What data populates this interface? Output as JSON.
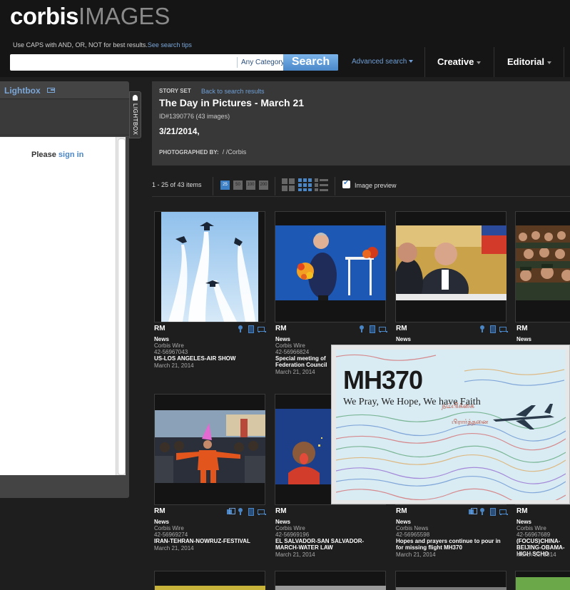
{
  "header": {
    "logo_primary": "corbis",
    "logo_secondary": "IMAGES",
    "tip_text": "Use CAPS with AND, OR, NOT for best results.",
    "tip_link": "See search tips",
    "search_placeholder": "",
    "category": "Any Category",
    "search_button": "Search",
    "advanced_search": "Advanced search",
    "nav_creative": "Creative",
    "nav_editorial": "Editorial"
  },
  "lightbox": {
    "title": "Lightbox",
    "please": "Please ",
    "sign_in": "sign in",
    "tab_label": "LIGHTBOX"
  },
  "story": {
    "kicker": "STORY SET",
    "back_link": "Back to search results",
    "title": "The Day in Pictures - March 21",
    "id_line": "ID#1390776 (43 images)",
    "date": "3/21/2014,",
    "photographed_label": "PHOTOGRAPHED BY:",
    "photographer": "/ /Corbis"
  },
  "toolbar": {
    "count": "1 - 25 of 43 items",
    "page_sizes": [
      "25",
      "50",
      "100",
      "200"
    ],
    "active_page_size": "25",
    "image_preview_label": "Image preview",
    "image_preview_checked": true
  },
  "cards": [
    {
      "rights": "RM",
      "type": "News",
      "source": "Corbis Wire",
      "id": "42-56967043",
      "caption": "US-LOS ANGELES-AIR SHOW",
      "date": "March 21, 2014"
    },
    {
      "rights": "RM",
      "type": "News",
      "source": "Corbis Wire",
      "id": "42-56966824",
      "caption": "Special meeting of Federation Council",
      "date": "March 21, 2014"
    },
    {
      "rights": "RM",
      "type": "News"
    },
    {
      "rights": "RM",
      "type": "News"
    },
    {
      "rights": "RM",
      "type": "News",
      "source": "Corbis Wire",
      "id": "42-56969274",
      "caption": "IRAN-TEHRAN-NOWRUZ-FESTIVAL",
      "date": "March 21, 2014"
    },
    {
      "rights": "RM",
      "type": "News",
      "source": "Corbis Wire",
      "id": "42-56969196",
      "caption": "EL SALVADOR-SAN SALVADOR-MARCH-WATER LAW",
      "date": "March 21, 2014"
    },
    {
      "rights": "RM",
      "type": "News",
      "source": "Corbis News",
      "id": "42-56965598",
      "caption": "Hopes and prayers continue to pour in for missing flight MH370",
      "date": "March 21, 2014"
    },
    {
      "rights": "RM",
      "type": "News",
      "source": "Corbis Wire",
      "id": "42-56967689",
      "caption": "(FOCUS)CHINA-BEIJING-OBAMA-HIGH SCHO",
      "date": "March 21, 2014"
    }
  ],
  "preview": {
    "headline": "MH370",
    "subline": "We Pray, We Hope, We have Faith"
  }
}
